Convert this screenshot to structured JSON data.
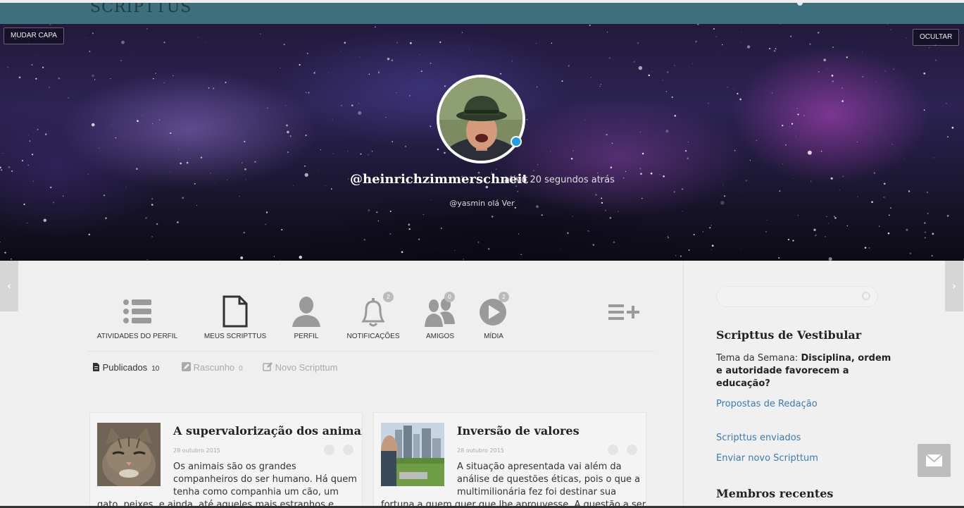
{
  "topbar": {
    "logo": "SCRIPTTUS"
  },
  "cover": {
    "change_cover": "MUDAR CAPA",
    "hide": "OCULTAR",
    "username": "@heinrichzimmerschneit",
    "activity": "ativo 20 segundos atrás",
    "mention": "@yasmin olá Ver"
  },
  "nav": {
    "items": [
      {
        "label": "ATIVIDADES DO PERFIL",
        "icon": "list-icon"
      },
      {
        "label": "MEUS SCRIPTTUS",
        "icon": "document-icon"
      },
      {
        "label": "PERFIL",
        "icon": "user-icon"
      },
      {
        "label": "NOTIFICAÇÕES",
        "icon": "bell-icon",
        "badge": "2"
      },
      {
        "label": "AMIGOS",
        "icon": "friends-icon",
        "badge": "0"
      },
      {
        "label": "MÍDIA",
        "icon": "play-icon",
        "badge": "2"
      }
    ],
    "more_icon": "list-plus-icon"
  },
  "subtabs": {
    "published": {
      "label": "Publicados",
      "count": "10"
    },
    "draft": {
      "label": "Rascunho",
      "count": "0"
    },
    "new": {
      "label": "Novo Scripttum"
    }
  },
  "posts": [
    {
      "title": "A supervalorização dos animais",
      "date": "28 outubro 2015",
      "excerpt": "Os animais são os grandes companheiros do ser humano. Há quem tenha como companhia um cão, um",
      "excerpt2": "gato, peixes, e ainda, até aqueles mais estranhos e"
    },
    {
      "title": "Inversão de valores",
      "date": "28 outubro 2015",
      "excerpt": "A situação apresentada vai além da análise de questões éticas, pois o que a multimilionária fez foi destinar sua",
      "excerpt2": "fortuna a quem quer que lhe aprouvesse. A questão a ser"
    }
  ],
  "sidebar": {
    "search_placeholder": "",
    "vestibular_title": "Scripttus de Vestibular",
    "theme_prefix": "Tema da Semana: ",
    "theme_bold": "Disciplina, ordem e autoridade favorecem a educação?",
    "proposals_link": "Propostas de Redação",
    "sent_link": "Scripttus enviados",
    "send_new_link": "Enviar novo Scripttum",
    "members_title": "Membros recentes"
  },
  "colors": {
    "topbar": "#3e6f7c",
    "link": "#3b7bb3",
    "online": "#1ea0e6",
    "icon": "#9a9a9a"
  }
}
